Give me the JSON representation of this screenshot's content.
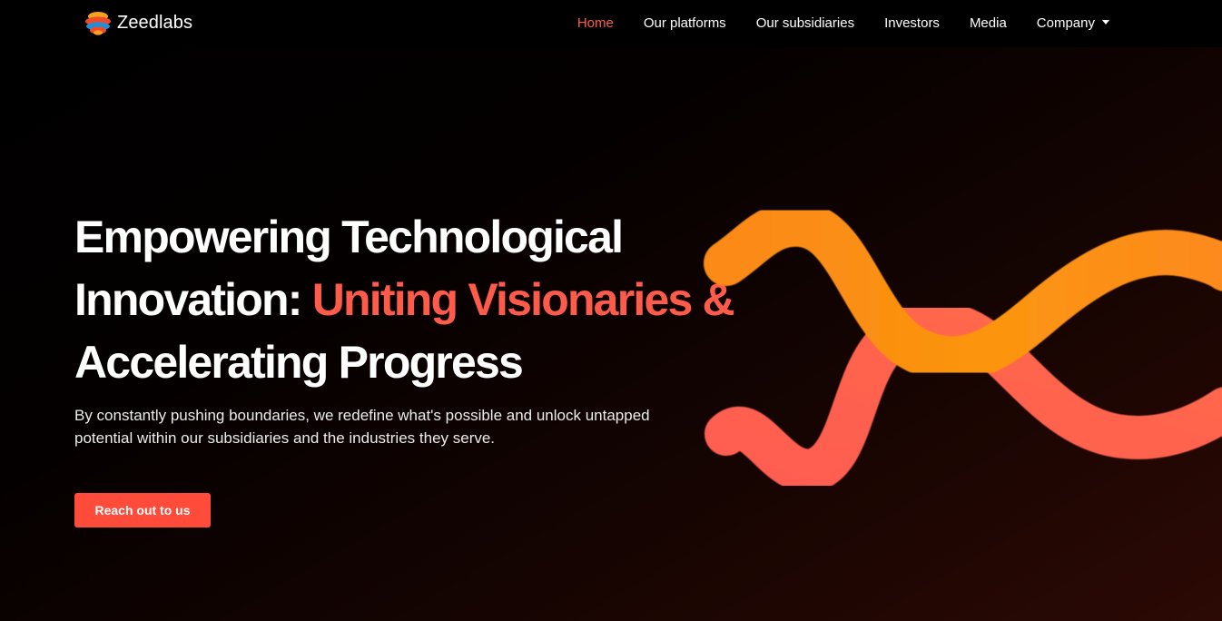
{
  "brand": {
    "name": "Zeedlabs",
    "logo_icon": "zeedlabs-logo-icon",
    "logo_colors": [
      "#f7a21c",
      "#ef4a2a",
      "#1f8fd6"
    ]
  },
  "nav": {
    "items": [
      {
        "label": "Home",
        "active": true
      },
      {
        "label": "Our platforms"
      },
      {
        "label": "Our subsidiaries"
      },
      {
        "label": "Investors"
      },
      {
        "label": "Media"
      },
      {
        "label": "Company",
        "dropdown_icon": "caret-down-icon"
      }
    ]
  },
  "hero": {
    "title_line1": "Empowering Technological",
    "title_line2_prefix": "Innovation: ",
    "title_line2_highlight": "Uniting Visionaries &",
    "title_line3": "Accelerating Progress",
    "description": "By constantly pushing boundaries, we redefine what's possible and unlock untapped potential within our subsidiaries and the industries they serve.",
    "cta_label": "Reach out to us",
    "graphic_icon": "infinity-ribbon-graphic"
  },
  "colors": {
    "accent": "#ff5b4a",
    "button": "#ff4b3a",
    "ribbon_orange": "#fb8f14",
    "ribbon_coral": "#fe5d52",
    "background": "#000000"
  }
}
